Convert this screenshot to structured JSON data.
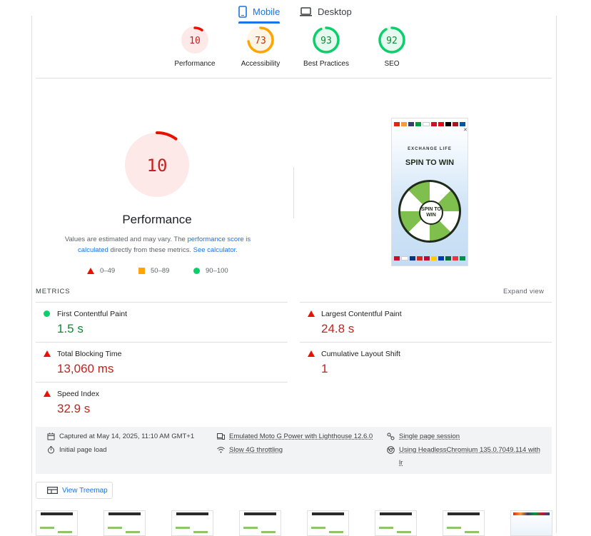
{
  "tabs": {
    "mobile": "Mobile",
    "desktop": "Desktop"
  },
  "categories": [
    {
      "name": "Performance",
      "score": "10",
      "value": 10,
      "color": "#eb0f00",
      "bg": "#fde9e7",
      "text": "#c5221f"
    },
    {
      "name": "Accessibility",
      "score": "73",
      "value": 73,
      "color": "#ffa400",
      "bg": "#fff5e6",
      "text": "#c33300"
    },
    {
      "name": "Best Practices",
      "score": "93",
      "value": 93,
      "color": "#0cce6b",
      "bg": "#e6f9ef",
      "text": "#0d8a38"
    },
    {
      "name": "SEO",
      "score": "92",
      "value": 92,
      "color": "#0cce6b",
      "bg": "#e6f9ef",
      "text": "#0d8a38"
    }
  ],
  "performance": {
    "score": "10",
    "title": "Performance",
    "desc_pre": "Values are estimated and may vary. The ",
    "desc_link1": "performance score is calculated",
    "desc_mid": " directly from these metrics. ",
    "desc_link2": "See calculator.",
    "legend": {
      "fail": "0–49",
      "average": "50–89",
      "pass": "90–100"
    }
  },
  "screenshot": {
    "brand": "EXCHANGE LIFE",
    "headline": "SPIN TO WIN",
    "center": "SPIN TO WIN"
  },
  "metrics": {
    "heading": "METRICS",
    "expand": "Expand view",
    "items": [
      {
        "title": "First Contentful Paint",
        "value": "1.5 s",
        "status": "pass"
      },
      {
        "title": "Largest Contentful Paint",
        "value": "24.8 s",
        "status": "fail"
      },
      {
        "title": "Total Blocking Time",
        "value": "13,060 ms",
        "status": "fail"
      },
      {
        "title": "Cumulative Layout Shift",
        "value": "1",
        "status": "fail"
      },
      {
        "title": "Speed Index",
        "value": "32.9 s",
        "status": "fail"
      }
    ]
  },
  "run_info": {
    "captured": "Captured at May 14, 2025, 11:10 AM GMT+1",
    "page_load": "Initial page load",
    "device": "Emulated Moto G Power with Lighthouse 12.6.0",
    "throttling": "Slow 4G throttling",
    "session": "Single page session",
    "browser_line1": "Using HeadlessChromium 135.0.7049.114 with",
    "browser_line2": "lr"
  },
  "treemap_button": "View Treemap"
}
